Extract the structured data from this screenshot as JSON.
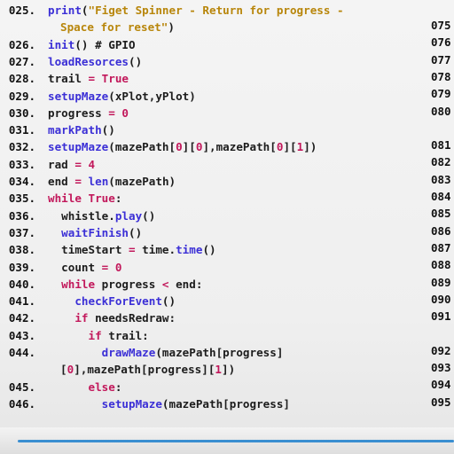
{
  "code_lines": [
    {
      "num": "025.",
      "tokens": [
        {
          "t": "print",
          "c": "fn"
        },
        {
          "t": "(",
          "c": "plain"
        },
        {
          "t": "\"Figet Spinner - Return for progress -",
          "c": "str"
        }
      ]
    },
    {
      "num": "",
      "cont": true,
      "tokens": [
        {
          "t": "Space for reset\"",
          "c": "str"
        },
        {
          "t": ")",
          "c": "plain"
        }
      ]
    },
    {
      "num": "026.",
      "tokens": [
        {
          "t": "init",
          "c": "fn"
        },
        {
          "t": "() # GPIO",
          "c": "comment"
        }
      ]
    },
    {
      "num": "027.",
      "tokens": [
        {
          "t": "loadResorces",
          "c": "fn"
        },
        {
          "t": "()",
          "c": "plain"
        }
      ]
    },
    {
      "num": "028.",
      "tokens": [
        {
          "t": "trail ",
          "c": "plain"
        },
        {
          "t": "=",
          "c": "op"
        },
        {
          "t": " True",
          "c": "kw"
        }
      ]
    },
    {
      "num": "029.",
      "tokens": [
        {
          "t": "setupMaze",
          "c": "fn"
        },
        {
          "t": "(xPlot,yPlot)",
          "c": "plain"
        }
      ]
    },
    {
      "num": "030.",
      "tokens": [
        {
          "t": "progress ",
          "c": "plain"
        },
        {
          "t": "=",
          "c": "op"
        },
        {
          "t": " 0",
          "c": "num"
        }
      ]
    },
    {
      "num": "031.",
      "tokens": [
        {
          "t": "markPath",
          "c": "fn"
        },
        {
          "t": "()",
          "c": "plain"
        }
      ]
    },
    {
      "num": "032.",
      "tokens": [
        {
          "t": "setupMaze",
          "c": "fn"
        },
        {
          "t": "(mazePath[",
          "c": "plain"
        },
        {
          "t": "0",
          "c": "num"
        },
        {
          "t": "][",
          "c": "plain"
        },
        {
          "t": "0",
          "c": "num"
        },
        {
          "t": "],mazePath[",
          "c": "plain"
        },
        {
          "t": "0",
          "c": "num"
        },
        {
          "t": "][",
          "c": "plain"
        },
        {
          "t": "1",
          "c": "num"
        },
        {
          "t": "])",
          "c": "plain"
        }
      ]
    },
    {
      "num": "033.",
      "tokens": [
        {
          "t": "rad ",
          "c": "plain"
        },
        {
          "t": "=",
          "c": "op"
        },
        {
          "t": " 4",
          "c": "num"
        }
      ]
    },
    {
      "num": "034.",
      "tokens": [
        {
          "t": "end ",
          "c": "plain"
        },
        {
          "t": "=",
          "c": "op"
        },
        {
          "t": " ",
          "c": "plain"
        },
        {
          "t": "len",
          "c": "fn"
        },
        {
          "t": "(mazePath)",
          "c": "plain"
        }
      ]
    },
    {
      "num": "035.",
      "tokens": [
        {
          "t": "while",
          "c": "kw"
        },
        {
          "t": " ",
          "c": "plain"
        },
        {
          "t": "True",
          "c": "kw"
        },
        {
          "t": ":",
          "c": "plain"
        }
      ]
    },
    {
      "num": "036.",
      "tokens": [
        {
          "t": "  whistle.",
          "c": "plain"
        },
        {
          "t": "play",
          "c": "fn"
        },
        {
          "t": "()",
          "c": "plain"
        }
      ]
    },
    {
      "num": "037.",
      "tokens": [
        {
          "t": "  ",
          "c": "plain"
        },
        {
          "t": "waitFinish",
          "c": "fn"
        },
        {
          "t": "()",
          "c": "plain"
        }
      ]
    },
    {
      "num": "038.",
      "tokens": [
        {
          "t": "  timeStart ",
          "c": "plain"
        },
        {
          "t": "=",
          "c": "op"
        },
        {
          "t": " time.",
          "c": "plain"
        },
        {
          "t": "time",
          "c": "fn"
        },
        {
          "t": "()",
          "c": "plain"
        }
      ]
    },
    {
      "num": "039.",
      "tokens": [
        {
          "t": "  count ",
          "c": "plain"
        },
        {
          "t": "=",
          "c": "op"
        },
        {
          "t": " 0",
          "c": "num"
        }
      ]
    },
    {
      "num": "040.",
      "tokens": [
        {
          "t": "  ",
          "c": "plain"
        },
        {
          "t": "while",
          "c": "kw"
        },
        {
          "t": " progress ",
          "c": "plain"
        },
        {
          "t": "<",
          "c": "op"
        },
        {
          "t": " end:",
          "c": "plain"
        }
      ]
    },
    {
      "num": "041.",
      "tokens": [
        {
          "t": "    ",
          "c": "plain"
        },
        {
          "t": "checkForEvent",
          "c": "fn"
        },
        {
          "t": "()",
          "c": "plain"
        }
      ]
    },
    {
      "num": "042.",
      "tokens": [
        {
          "t": "    ",
          "c": "plain"
        },
        {
          "t": "if",
          "c": "kw"
        },
        {
          "t": " needsRedraw:",
          "c": "plain"
        }
      ]
    },
    {
      "num": "043.",
      "tokens": [
        {
          "t": "      ",
          "c": "plain"
        },
        {
          "t": "if",
          "c": "kw"
        },
        {
          "t": " trail:",
          "c": "plain"
        }
      ]
    },
    {
      "num": "044.",
      "tokens": [
        {
          "t": "        ",
          "c": "plain"
        },
        {
          "t": "drawMaze",
          "c": "fn"
        },
        {
          "t": "(mazePath[progress]",
          "c": "plain"
        }
      ]
    },
    {
      "num": "",
      "cont": true,
      "tokens": [
        {
          "t": "[",
          "c": "plain"
        },
        {
          "t": "0",
          "c": "num"
        },
        {
          "t": "],mazePath[progress][",
          "c": "plain"
        },
        {
          "t": "1",
          "c": "num"
        },
        {
          "t": "])",
          "c": "plain"
        }
      ]
    },
    {
      "num": "045.",
      "tokens": [
        {
          "t": "      ",
          "c": "plain"
        },
        {
          "t": "else",
          "c": "kw"
        },
        {
          "t": ":",
          "c": "plain"
        }
      ]
    },
    {
      "num": "046.",
      "tokens": [
        {
          "t": "        ",
          "c": "plain"
        },
        {
          "t": "setupMaze",
          "c": "fn"
        },
        {
          "t": "(mazePath[progress]",
          "c": "plain"
        }
      ]
    }
  ],
  "right_line_numbers": [
    {
      "line_index": 0,
      "text": "075"
    },
    {
      "line_index": 1,
      "text": "076"
    },
    {
      "line_index": 2,
      "text": "077"
    },
    {
      "line_index": 3,
      "text": "078"
    },
    {
      "line_index": 4,
      "text": "079"
    },
    {
      "line_index": 5,
      "text": "080"
    },
    {
      "line_index": 7,
      "text": "081"
    },
    {
      "line_index": 8,
      "text": "082"
    },
    {
      "line_index": 9,
      "text": "083"
    },
    {
      "line_index": 10,
      "text": "084"
    },
    {
      "line_index": 11,
      "text": "085"
    },
    {
      "line_index": 12,
      "text": "086"
    },
    {
      "line_index": 13,
      "text": "087"
    },
    {
      "line_index": 14,
      "text": "088"
    },
    {
      "line_index": 15,
      "text": "089"
    },
    {
      "line_index": 16,
      "text": "090"
    },
    {
      "line_index": 17,
      "text": "091"
    },
    {
      "line_index": 19,
      "text": "092"
    },
    {
      "line_index": 20,
      "text": "093"
    },
    {
      "line_index": 21,
      "text": "094"
    },
    {
      "line_index": 22,
      "text": "095"
    }
  ],
  "colors": {
    "function": "#3b2fd6",
    "keyword": "#c2185b",
    "string": "#b8860b",
    "accent_line": "#3b8fd1"
  }
}
